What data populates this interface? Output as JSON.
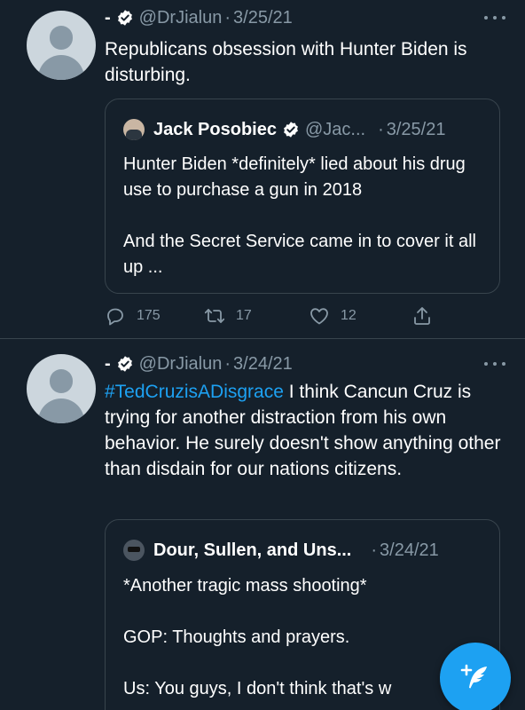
{
  "tweets": [
    {
      "name": "-",
      "handle": "@DrJialun",
      "date": "3/25/21",
      "text": "Republicans obsession with Hunter Biden is disturbing.",
      "quote": {
        "name": "Jack Posobiec",
        "handle": "@Jac...",
        "date": "3/25/21",
        "text": "Hunter Biden *definitely* lied about his drug use to purchase a gun in 2018\n\nAnd the Secret Service came in to cover it all up ..."
      },
      "actions": {
        "replies": "175",
        "retweets": "17",
        "likes": "12"
      }
    },
    {
      "name": "-",
      "handle": "@DrJialun",
      "date": "3/24/21",
      "hashtag": "#TedCruzisADisgrace",
      "text": " I think Cancun Cruz is trying for another distraction from his own behavior. He surely doesn't show anything other than disdain for our nations citizens.",
      "quote": {
        "name": "Dour, Sullen, and Uns...",
        "date": "3/24/21",
        "text": "*Another tragic mass shooting*\n\nGOP: Thoughts and prayers.\n\nUs: You guys, I don't think that's w"
      }
    }
  ],
  "icons": {
    "verified": "verified-badge-icon",
    "more": "more-options-icon",
    "reply": "reply-icon",
    "retweet": "retweet-icon",
    "like": "heart-icon",
    "share": "share-icon",
    "compose": "compose-tweet-icon"
  },
  "colors": {
    "background": "#15202b",
    "border": "#38444d",
    "muted": "#8899a6",
    "accent": "#1da1f2"
  }
}
